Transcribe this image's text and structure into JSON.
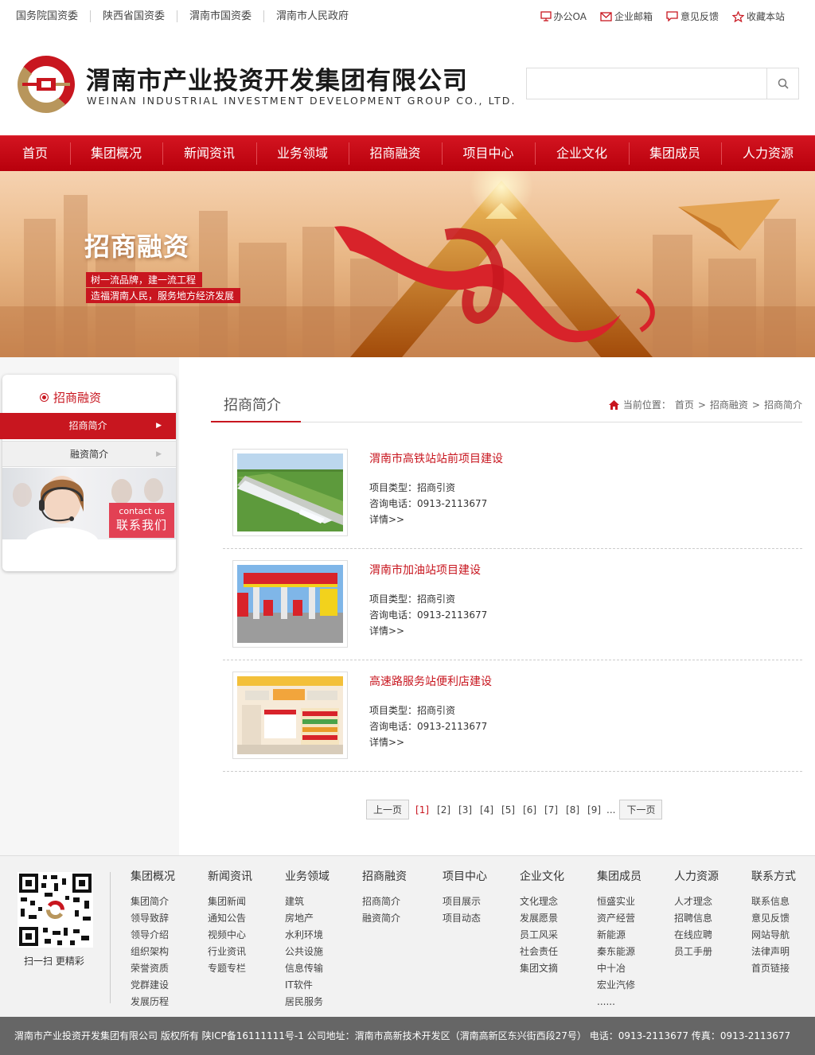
{
  "top_links": [
    "国务院国资委",
    "陕西省国资委",
    "渭南市国资委",
    "渭南市人民政府"
  ],
  "top_tools": [
    {
      "label": "办公OA",
      "icon": "monitor-icon"
    },
    {
      "label": "企业邮箱",
      "icon": "mail-icon"
    },
    {
      "label": "意见反馈",
      "icon": "chat-icon"
    },
    {
      "label": "收藏本站",
      "icon": "star-icon"
    }
  ],
  "logo": {
    "title": "渭南市产业投资开发集团有限公司",
    "subtitle": "WEINAN INDUSTRIAL INVESTMENT DEVELOPMENT GROUP CO., LTD."
  },
  "search": {
    "placeholder": ""
  },
  "nav": [
    "首页",
    "集团概况",
    "新闻资讯",
    "业务领域",
    "招商融资",
    "项目中心",
    "企业文化",
    "集团成员",
    "人力资源"
  ],
  "banner": {
    "title": "招商融资",
    "slogan1": "树一流品牌，建一流工程",
    "slogan2": "造福渭南人民，服务地方经济发展"
  },
  "sidebar": {
    "title": "招商融资",
    "items": [
      {
        "label": "招商简介"
      },
      {
        "label": "融资简介"
      }
    ],
    "contact_en": "contact us",
    "contact_cn": "联系我们"
  },
  "content": {
    "title": "招商简介",
    "breadcrumb": {
      "prefix": "当前位置：",
      "items": [
        "首页",
        "招商融资",
        "招商简介"
      ],
      "sep": ">"
    }
  },
  "projects": [
    {
      "title": "渭南市高铁站站前项目建设",
      "type": "项目类型：招商引资",
      "phone": "咨询电话：0913-2113677",
      "more": "详情>>"
    },
    {
      "title": "渭南市加油站项目建设",
      "type": "项目类型：招商引资",
      "phone": "咨询电话：0913-2113677",
      "more": "详情>>"
    },
    {
      "title": "高速路服务站便利店建设",
      "type": "项目类型：招商引资",
      "phone": "咨询电话：0913-2113677",
      "more": "详情>>"
    }
  ],
  "pagination": {
    "prev": "上一页",
    "pages": [
      "[1]",
      "[2]",
      "[3]",
      "[4]",
      "[5]",
      "[6]",
      "[7]",
      "[8]",
      "[9]"
    ],
    "ellipsis": "...",
    "next": "下一页"
  },
  "footer": {
    "qr_caption": "扫一扫 更精彩",
    "columns": [
      {
        "head": "集团概况",
        "items": [
          "集团简介",
          "领导致辞",
          "领导介绍",
          "组织架构",
          "荣誉资质",
          "党群建设",
          "发展历程"
        ]
      },
      {
        "head": "新闻资讯",
        "items": [
          "集团新闻",
          "通知公告",
          "视频中心",
          "行业资讯",
          "专题专栏"
        ]
      },
      {
        "head": "业务领域",
        "items": [
          "建筑",
          "房地产",
          "水利环境",
          "公共设施",
          "信息传输",
          "IT软件",
          "居民服务"
        ]
      },
      {
        "head": "招商融资",
        "items": [
          "招商简介",
          "融资简介"
        ]
      },
      {
        "head": "项目中心",
        "items": [
          "项目展示",
          "项目动态"
        ]
      },
      {
        "head": "企业文化",
        "items": [
          "文化理念",
          "发展愿景",
          "员工风采",
          "社会责任",
          "集团文摘"
        ]
      },
      {
        "head": "集团成员",
        "items": [
          "恒盛实业",
          "资产经营",
          "新能源",
          "秦东能源",
          "中十冶",
          "宏业汽修",
          "......"
        ]
      },
      {
        "head": "人力资源",
        "items": [
          "人才理念",
          "招聘信息",
          "在线应聘",
          "员工手册"
        ]
      },
      {
        "head": "联系方式",
        "items": [
          "联系信息",
          "意见反馈",
          "网站导航",
          "法律声明",
          "首页链接"
        ]
      }
    ],
    "copyright": "渭南市产业投资开发集团有限公司  版权所有    陕ICP备16111111号-1    公司地址：渭南市高新技术开发区（渭南高新区东兴街西段27号）    电话：0913-2113677    传真：0913-2113677"
  },
  "colors": {
    "brand_red": "#c8161f",
    "footer_bar": "#666666"
  }
}
